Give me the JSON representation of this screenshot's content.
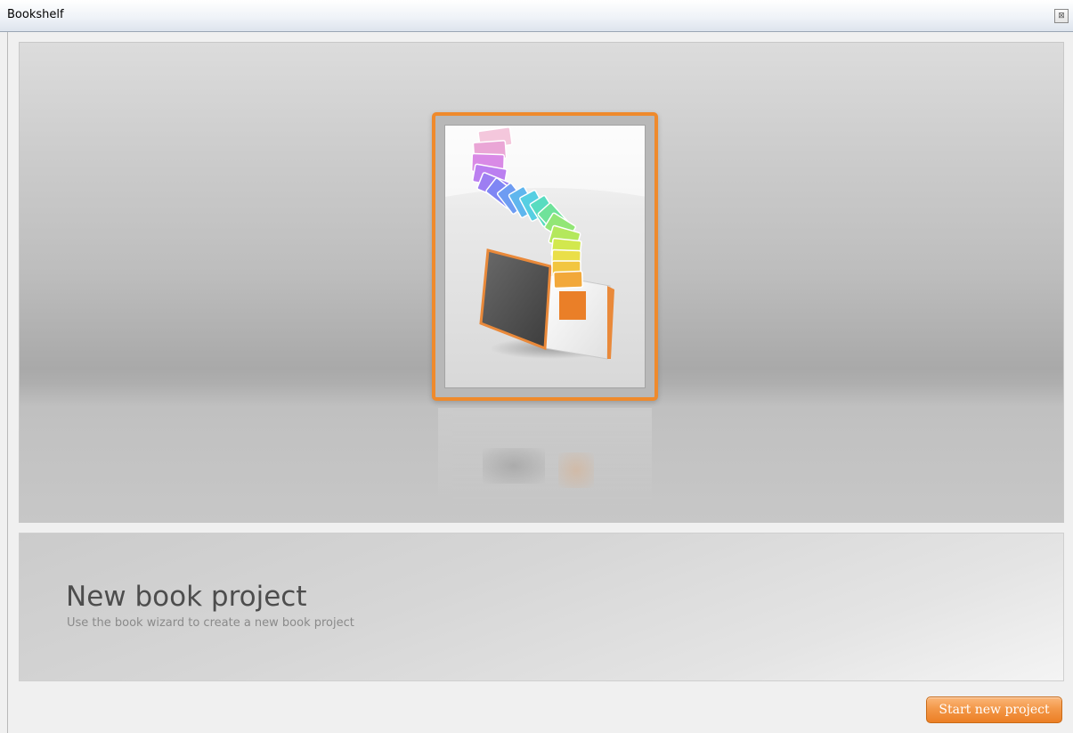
{
  "window": {
    "title": "Bookshelf",
    "close_glyph": "⊠"
  },
  "project": {
    "title": "New book project",
    "description": "Use the book wizard to create a new book project",
    "icon": "book-wizard-icon",
    "selected": true
  },
  "actions": {
    "start_label": "Start new project"
  },
  "colors": {
    "accent": "#ef8a2c",
    "button_top": "#fbb77a",
    "button_bottom": "#ec7f25",
    "title_text": "#4d4d4d",
    "subtitle_text": "#8a8a8a"
  }
}
